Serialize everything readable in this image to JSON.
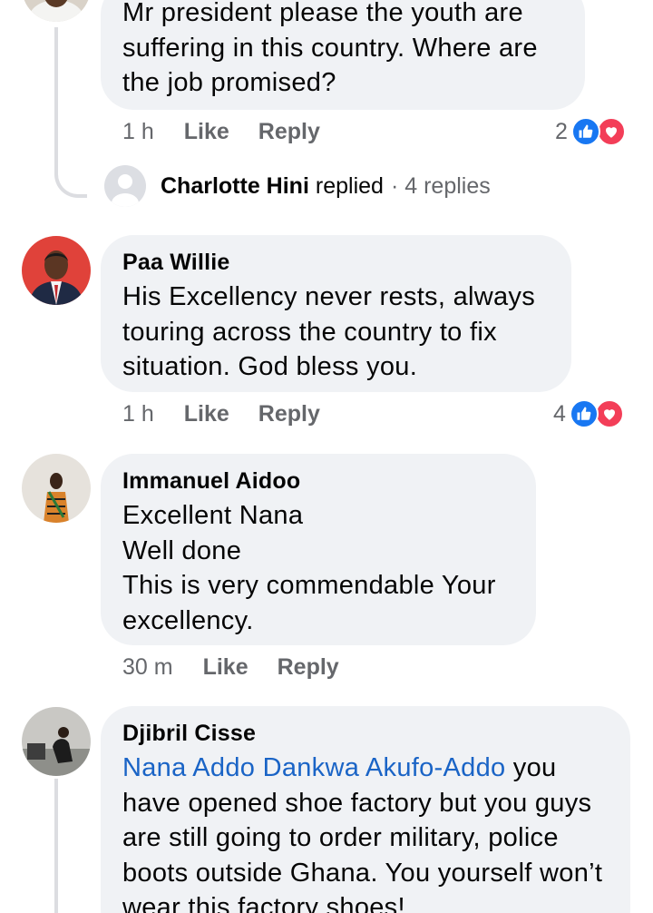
{
  "comments": [
    {
      "body": "Mr president please the youth are suffering in this country. Where are the job promised?",
      "time": "1 h",
      "like_label": "Like",
      "reply_label": "Reply",
      "reaction_count": "2",
      "replies_preview": {
        "name": "Charlotte Hini",
        "verb": "replied",
        "count": "· 4 replies"
      }
    },
    {
      "author": "Paa Willie",
      "body": "His Excellency never rests, always touring across the country to fix situation. God bless you.",
      "time": "1 h",
      "like_label": "Like",
      "reply_label": "Reply",
      "reaction_count": "4"
    },
    {
      "author": "Immanuel Aidoo",
      "body_lines": [
        "Excellent Nana",
        "Well done",
        "This is very commendable Your excellency."
      ],
      "time": "30 m",
      "like_label": "Like",
      "reply_label": "Reply"
    },
    {
      "author": "Djibril Cisse",
      "mention": "Nana Addo Dankwa Akufo-Addo",
      "body": " you have opened shoe factory but you guys are still going to order military, police boots outside Ghana. You yourself won’t wear this factory shoes!"
    }
  ],
  "icons": {
    "like": "thumbs-up-icon",
    "love": "heart-icon"
  },
  "colors": {
    "bubble": "#f0f2f5",
    "meta_text": "#65676b",
    "mention": "#1a64c6",
    "like": "#1877f2",
    "love": "#f33e58"
  }
}
